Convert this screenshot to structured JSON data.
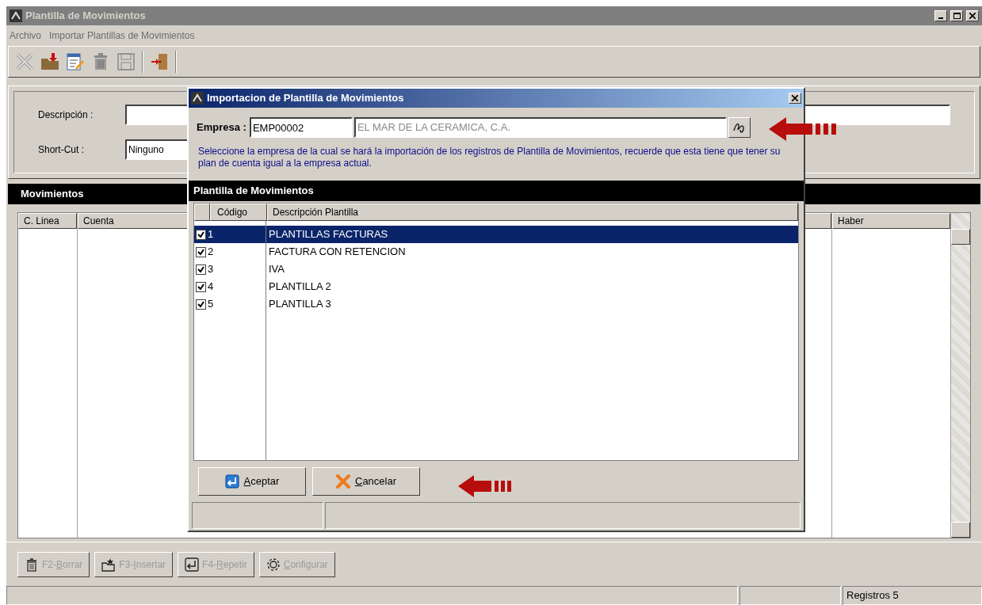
{
  "window": {
    "title": "Plantilla de Movimientos"
  },
  "menu": [
    "Archivo",
    "Importar Plantillas de Movimientos"
  ],
  "form": {
    "descripcion_label": "Descripción :",
    "short_cut_label": "Short-Cut :",
    "short_cut_value": "Ninguno"
  },
  "movimientos": {
    "title": "Movimientos",
    "columns": [
      "C. Linea",
      "Cuenta",
      "Haber"
    ]
  },
  "bottom_buttons": [
    {
      "before": "F2-",
      "mnemonic": "B",
      "after": "orrar",
      "disabled": true
    },
    {
      "before": "F3-",
      "mnemonic": "I",
      "after": "nsertar",
      "disabled": true
    },
    {
      "before": "F4-",
      "mnemonic": "R",
      "after": "epetir",
      "disabled": true
    },
    {
      "mnemonic": "C",
      "after": "onfigurar",
      "disabled": true
    }
  ],
  "status_bar": [
    "Registros 5"
  ],
  "dialog": {
    "title": "Importacion de Plantilla de Movimientos",
    "empresa_label": "Empresa :",
    "empresa_code": "EMP00002",
    "empresa_name": "EL MAR DE LA CERAMICA, C.A.",
    "message": "Seleccione la empresa de la cual se hará la importación de los registros de Plantilla de Movimientos, recuerde que esta tiene que tener su plan de cuenta igual a la empresa actual.",
    "section_title": "Plantilla de Movimientos",
    "columns": [
      "Código",
      "Descripción Plantilla"
    ],
    "rows": [
      {
        "codigo": "1",
        "descripcion": "PLANTILLAS FACTURAS",
        "checked": true,
        "selected": true
      },
      {
        "codigo": "2",
        "descripcion": "FACTURA CON RETENCION",
        "checked": true,
        "selected": false
      },
      {
        "codigo": "3",
        "descripcion": "IVA",
        "checked": true,
        "selected": false
      },
      {
        "codigo": "4",
        "descripcion": "PLANTILLA 2",
        "checked": true,
        "selected": false
      },
      {
        "codigo": "5",
        "descripcion": "PLANTILLA 3",
        "checked": true,
        "selected": false
      }
    ],
    "buttons": [
      {
        "mnemonic": "A",
        "after": "ceptar"
      },
      {
        "mnemonic": "C",
        "after": "ancelar"
      }
    ]
  }
}
